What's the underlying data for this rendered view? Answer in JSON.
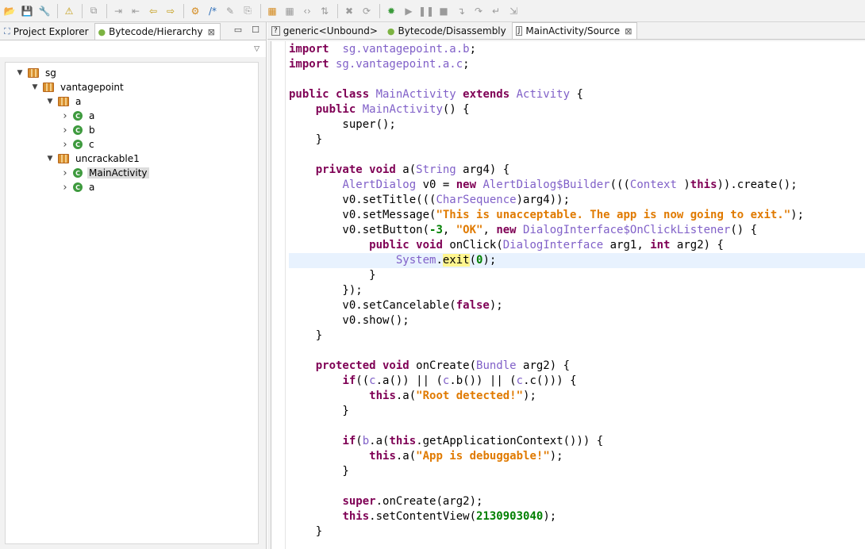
{
  "toolbar": {
    "buttons": [
      {
        "name": "open-folder-icon",
        "glyph": "📂",
        "color": "c-orange"
      },
      {
        "name": "save-icon",
        "glyph": "💾",
        "color": "c-blue"
      },
      {
        "name": "wrench-icon",
        "glyph": "🔧",
        "color": "c-blue"
      },
      {
        "sep": true
      },
      {
        "name": "warning-icon",
        "glyph": "⚠",
        "color": "c-yellow"
      },
      {
        "sep": true
      },
      {
        "name": "new-window-icon",
        "glyph": "⧉",
        "color": "c-gray"
      },
      {
        "sep": true
      },
      {
        "name": "jump-to-icon",
        "glyph": "⇥",
        "color": "c-gray"
      },
      {
        "name": "jump-list-icon",
        "glyph": "⇤",
        "color": "c-gray"
      },
      {
        "name": "back-arrow-icon",
        "glyph": "⇦",
        "color": "c-yellow"
      },
      {
        "name": "forward-arrow-icon",
        "glyph": "⇨",
        "color": "c-yellow"
      },
      {
        "sep": true
      },
      {
        "name": "xrefs-icon",
        "glyph": "⚙",
        "color": "c-orange"
      },
      {
        "name": "comment-icon",
        "glyph": "/*",
        "color": "c-blue"
      },
      {
        "name": "rename-pencil-icon",
        "glyph": "✎",
        "color": "c-gray"
      },
      {
        "name": "decompile-icon",
        "glyph": "⎘",
        "color": "c-gray"
      },
      {
        "sep": true
      },
      {
        "name": "package-icon",
        "glyph": "▦",
        "color": "c-orange"
      },
      {
        "name": "grid-icon",
        "glyph": "▦",
        "color": "c-gray"
      },
      {
        "name": "code-icon",
        "glyph": "‹›",
        "color": "c-gray"
      },
      {
        "name": "sort-icon",
        "glyph": "⇅",
        "color": "c-gray"
      },
      {
        "sep": true
      },
      {
        "name": "delete-icon",
        "glyph": "✖",
        "color": "c-gray"
      },
      {
        "name": "refresh-icon",
        "glyph": "⟳",
        "color": "c-gray"
      },
      {
        "sep": true
      },
      {
        "name": "debug-icon",
        "glyph": "✹",
        "color": "c-green"
      },
      {
        "name": "resume-icon",
        "glyph": "▶",
        "color": "c-gray"
      },
      {
        "name": "pause-icon",
        "glyph": "❚❚",
        "color": "c-gray"
      },
      {
        "name": "stop-icon",
        "glyph": "■",
        "color": "c-gray"
      },
      {
        "name": "step-into-icon",
        "glyph": "↴",
        "color": "c-gray"
      },
      {
        "name": "step-over-icon",
        "glyph": "↷",
        "color": "c-gray"
      },
      {
        "name": "step-return-icon",
        "glyph": "↵",
        "color": "c-gray"
      },
      {
        "name": "run-to-line-icon",
        "glyph": "⇲",
        "color": "c-gray"
      }
    ]
  },
  "left_panel": {
    "tabs": [
      {
        "name": "tab-project-explorer",
        "icon": "project-explorer-icon",
        "glyph": "⛶",
        "label": "Project Explorer",
        "active": false,
        "closable": false
      },
      {
        "name": "tab-bytecode-hierarchy",
        "icon": "android-icon",
        "glyph": "●",
        "label": "Bytecode/Hierarchy",
        "active": true,
        "closable": true
      }
    ],
    "tree": [
      {
        "depth": 0,
        "twisty": "v",
        "kind": "pkg",
        "label": "sg"
      },
      {
        "depth": 1,
        "twisty": "v",
        "kind": "pkg",
        "label": "vantagepoint"
      },
      {
        "depth": 2,
        "twisty": "v",
        "kind": "pkg",
        "label": "a"
      },
      {
        "depth": 3,
        "twisty": ">",
        "kind": "cls",
        "label": "a"
      },
      {
        "depth": 3,
        "twisty": ">",
        "kind": "cls",
        "label": "b"
      },
      {
        "depth": 3,
        "twisty": ">",
        "kind": "cls",
        "label": "c"
      },
      {
        "depth": 2,
        "twisty": "v",
        "kind": "pkg",
        "label": "uncrackable1"
      },
      {
        "depth": 3,
        "twisty": ">",
        "kind": "cls",
        "label": "MainActivity",
        "selected": true
      },
      {
        "depth": 3,
        "twisty": ">",
        "kind": "cls",
        "label": "a"
      }
    ]
  },
  "editor_tabs": [
    {
      "name": "tab-generic-unbound",
      "icon": "question-icon",
      "glyph": "?",
      "label": "generic<Unbound>",
      "active": false,
      "closable": false
    },
    {
      "name": "tab-bytecode-disassembly",
      "icon": "android-icon",
      "glyph": "●",
      "label": "Bytecode/Disassembly",
      "active": false,
      "closable": false
    },
    {
      "name": "tab-mainactivity-source",
      "icon": "java-file-icon",
      "glyph": "J",
      "label": "MainActivity/Source",
      "active": true,
      "closable": true
    }
  ],
  "code": {
    "highlight_line": 14,
    "lines": [
      [
        [
          "k",
          "import"
        ],
        [
          "",
          "  "
        ],
        [
          "t",
          "sg.vantagepoint.a.b"
        ],
        [
          "",
          ";"
        ]
      ],
      [
        [
          "k",
          "import"
        ],
        [
          "",
          ""
        ],
        [
          "t",
          " sg.vantagepoint.a.c"
        ],
        [
          "",
          ";"
        ]
      ],
      [],
      [
        [
          "k",
          "public class "
        ],
        [
          "t",
          "MainActivity"
        ],
        [
          "k",
          " extends "
        ],
        [
          "t",
          "Activity"
        ],
        [
          "",
          " {"
        ]
      ],
      [
        [
          "",
          "    "
        ],
        [
          "k",
          "public "
        ],
        [
          "t",
          "MainActivity"
        ],
        [
          "",
          "() {"
        ]
      ],
      [
        [
          "",
          "        super();"
        ]
      ],
      [
        [
          "",
          "    }"
        ]
      ],
      [],
      [
        [
          "",
          "    "
        ],
        [
          "k",
          "private void "
        ],
        [
          "",
          "a("
        ],
        [
          "t",
          "String"
        ],
        [
          "",
          " arg4) {"
        ]
      ],
      [
        [
          "",
          "        "
        ],
        [
          "t",
          "AlertDialog"
        ],
        [
          "",
          " v0 = "
        ],
        [
          "k",
          "new "
        ],
        [
          "t",
          "AlertDialog$Builder"
        ],
        [
          "",
          "((("
        ],
        [
          "t",
          "Context"
        ],
        [
          "",
          " )"
        ],
        [
          "k",
          "this"
        ],
        [
          "",
          "))"
        ],
        [
          "",
          ".create();"
        ]
      ],
      [
        [
          "",
          "        v0.setTitle((("
        ],
        [
          "t",
          "CharSequence"
        ],
        [
          "",
          ")arg4));"
        ]
      ],
      [
        [
          "",
          "        v0.setMessage("
        ],
        [
          "s",
          "\"This is unacceptable. The app is now going to exit.\""
        ],
        [
          "",
          ");"
        ]
      ],
      [
        [
          "",
          "        v0.setButton("
        ],
        [
          "n",
          "-3"
        ],
        [
          "",
          ", "
        ],
        [
          "s",
          "\"OK\""
        ],
        [
          "",
          ", "
        ],
        [
          "k",
          "new "
        ],
        [
          "t",
          "DialogInterface$OnClickListener"
        ],
        [
          "",
          "() {"
        ]
      ],
      [
        [
          "",
          "            "
        ],
        [
          "k",
          "public void "
        ],
        [
          "",
          "onClick("
        ],
        [
          "t",
          "DialogInterface"
        ],
        [
          "",
          " arg1, "
        ],
        [
          "k",
          "int"
        ],
        [
          "",
          " arg2) {"
        ]
      ],
      [
        [
          "",
          "                "
        ],
        [
          "t",
          "System"
        ],
        [
          "",
          "."
        ],
        [
          "m",
          "exit"
        ],
        [
          "",
          "("
        ],
        [
          "n",
          "0"
        ],
        [
          "",
          ");"
        ]
      ],
      [
        [
          "",
          "            }"
        ]
      ],
      [
        [
          "",
          "        });"
        ]
      ],
      [
        [
          "",
          "        v0.setCancelable("
        ],
        [
          "k",
          "false"
        ],
        [
          "",
          ");"
        ]
      ],
      [
        [
          "",
          "        v0.show();"
        ]
      ],
      [
        [
          "",
          "    }"
        ]
      ],
      [],
      [
        [
          "",
          "    "
        ],
        [
          "k",
          "protected void "
        ],
        [
          "",
          "onCreate("
        ],
        [
          "t",
          "Bundle"
        ],
        [
          "",
          " arg2) {"
        ]
      ],
      [
        [
          "",
          "        "
        ],
        [
          "k",
          "if"
        ],
        [
          "",
          "(("
        ],
        [
          "t",
          "c"
        ],
        [
          "",
          ".a()) || ("
        ],
        [
          "t",
          "c"
        ],
        [
          "",
          ".b()) || ("
        ],
        [
          "t",
          "c"
        ],
        [
          "",
          ".c())) {"
        ]
      ],
      [
        [
          "",
          "            "
        ],
        [
          "k",
          "this"
        ],
        [
          "",
          ".a("
        ],
        [
          "s",
          "\"Root detected!\""
        ],
        [
          "",
          ");"
        ]
      ],
      [
        [
          "",
          "        }"
        ]
      ],
      [],
      [
        [
          "",
          "        "
        ],
        [
          "k",
          "if"
        ],
        [
          "",
          "("
        ],
        [
          "t",
          "b"
        ],
        [
          "",
          ".a("
        ],
        [
          "k",
          "this"
        ],
        [
          "",
          ".getApplicationContext())) {"
        ]
      ],
      [
        [
          "",
          "            "
        ],
        [
          "k",
          "this"
        ],
        [
          "",
          ".a("
        ],
        [
          "s",
          "\"App is debuggable!\""
        ],
        [
          "",
          ");"
        ]
      ],
      [
        [
          "",
          "        }"
        ]
      ],
      [],
      [
        [
          "",
          "        "
        ],
        [
          "k",
          "super"
        ],
        [
          "",
          ".onCreate(arg2);"
        ]
      ],
      [
        [
          "",
          "        "
        ],
        [
          "k",
          "this"
        ],
        [
          "",
          ".setContentView("
        ],
        [
          "n",
          "2130903040"
        ],
        [
          "",
          ");"
        ]
      ],
      [
        [
          "",
          "    }"
        ]
      ]
    ]
  }
}
